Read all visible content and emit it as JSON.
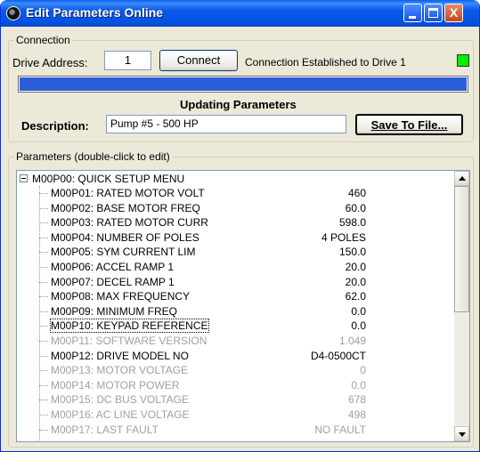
{
  "window": {
    "title": "Edit Parameters Online",
    "controls": {
      "minimize": "minimize",
      "maximize": "maximize",
      "close": "X"
    }
  },
  "connection": {
    "group_label": "Connection",
    "drive_address_label": "Drive Address:",
    "drive_address_value": "1",
    "connect_label": "Connect",
    "status_text": "Connection Established to Drive 1",
    "led_color": "#00ee00",
    "progress_fraction": 1.0,
    "progress_color": "#2c5ed7",
    "updating_text": "Updating Parameters",
    "description_label": "Description:",
    "description_value": "Pump #5 - 500 HP",
    "save_label": "Save To File..."
  },
  "parameters": {
    "group_label": "Parameters (double-click to edit)",
    "root_label": "M00P00: QUICK SETUP MENU",
    "items": [
      {
        "name": "M00P01: RATED MOTOR VOLT",
        "value": "460",
        "enabled": true
      },
      {
        "name": "M00P02: BASE MOTOR FREQ",
        "value": "60.0",
        "enabled": true
      },
      {
        "name": "M00P03: RATED MOTOR CURR",
        "value": "598.0",
        "enabled": true
      },
      {
        "name": "M00P04: NUMBER OF POLES",
        "value": "4 POLES",
        "enabled": true
      },
      {
        "name": "M00P05: SYM CURRENT LIM",
        "value": "150.0",
        "enabled": true
      },
      {
        "name": "M00P06:   ACCEL RAMP 1",
        "value": "20.0",
        "enabled": true
      },
      {
        "name": "M00P07:   DECEL RAMP 1",
        "value": "20.0",
        "enabled": true
      },
      {
        "name": "M00P08:  MAX FREQUENCY",
        "value": "62.0",
        "enabled": true
      },
      {
        "name": "M00P09:   MINIMUM FREQ",
        "value": "0.0",
        "enabled": true
      },
      {
        "name": "M00P10: KEYPAD REFERENCE",
        "value": "0.0",
        "enabled": true,
        "focused": true
      },
      {
        "name": "M00P11: SOFTWARE VERSION",
        "value": "1.049",
        "enabled": false
      },
      {
        "name": "M00P12:  DRIVE MODEL NO",
        "value": "D4-0500CT",
        "enabled": true
      },
      {
        "name": "M00P13:   MOTOR VOLTAGE",
        "value": "0",
        "enabled": false
      },
      {
        "name": "M00P14:     MOTOR POWER",
        "value": "0.0",
        "enabled": false
      },
      {
        "name": "M00P15:  DC BUS VOLTAGE",
        "value": "678",
        "enabled": false
      },
      {
        "name": "M00P16: AC LINE VOLTAGE",
        "value": "498",
        "enabled": false
      },
      {
        "name": "M00P17:     LAST FAULT",
        "value": "NO FAULT",
        "enabled": false
      }
    ]
  }
}
